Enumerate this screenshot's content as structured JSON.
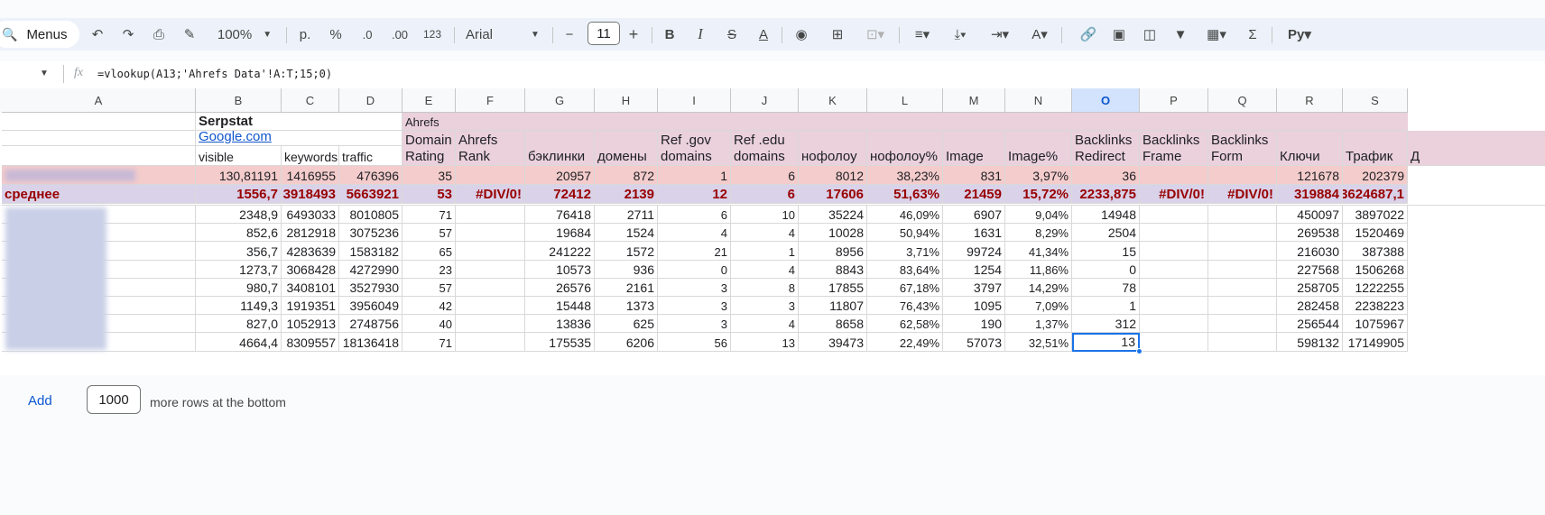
{
  "toolbar": {
    "menus_label": "Menus",
    "zoom": "100%",
    "currency": "р.",
    "percent": "%",
    "dec_decrease": ".0",
    "dec_increase": ".00",
    "number_format": "123",
    "font": "Arial",
    "font_size": "11"
  },
  "formula": {
    "text": "=vlookup(A13;'Ahrefs Data'!A:T;15;0)"
  },
  "columns": [
    "A",
    "B",
    "C",
    "D",
    "E",
    "F",
    "G",
    "H",
    "I",
    "J",
    "K",
    "L",
    "M",
    "N",
    "O",
    "P",
    "Q",
    "R",
    "S"
  ],
  "selected_column": "O",
  "header_rows": {
    "row1": {
      "serpstat": "Serpstat",
      "ahrefs": "Ahrefs"
    },
    "row2": {
      "google": "Google.com"
    },
    "row3": {
      "visible": "visible",
      "keywords": "keywords",
      "traffic": "traffic",
      "E": [
        "Domain",
        "Rating"
      ],
      "F": [
        "Ahrefs",
        "Rank"
      ],
      "G": "бэклинки",
      "H": "домены",
      "I": [
        "Ref .gov",
        "domains"
      ],
      "J": [
        "Ref .edu",
        "domains"
      ],
      "K": "нофолоу",
      "L": "нофолоу%",
      "M": "Image",
      "N": "Image%",
      "O": [
        "Backlinks",
        "Redirect"
      ],
      "P": [
        "Backlinks",
        "Frame"
      ],
      "Q": [
        "Backlinks",
        "Form"
      ],
      "R": "Ключи",
      "S": "Трафик",
      "T": "Д"
    }
  },
  "own_row": [
    "",
    "130,81191",
    "1416955",
    "476396",
    "35",
    "",
    "20957",
    "872",
    "1",
    "6",
    "8012",
    "38,23%",
    "831",
    "3,97%",
    "36",
    "",
    "",
    "121678",
    "202379"
  ],
  "avg_row": [
    "среднее",
    "1556,7",
    "3918493",
    "5663921",
    "53",
    "#DIV/0!",
    "72412",
    "2139",
    "12",
    "6",
    "17606",
    "51,63%",
    "21459",
    "15,72%",
    "2233,875",
    "#DIV/0!",
    "#DIV/0!",
    "319884",
    "3624687,1"
  ],
  "data_rows": [
    [
      "",
      "2348,9",
      "6493033",
      "8010805",
      "71",
      "",
      "76418",
      "2711",
      "6",
      "10",
      "35224",
      "46,09%",
      "6907",
      "9,04%",
      "14948",
      "",
      "",
      "450097",
      "3897022"
    ],
    [
      "",
      "852,6",
      "2812918",
      "3075236",
      "57",
      "",
      "19684",
      "1524",
      "4",
      "4",
      "10028",
      "50,94%",
      "1631",
      "8,29%",
      "2504",
      "",
      "",
      "269538",
      "1520469"
    ],
    [
      "",
      "356,7",
      "4283639",
      "1583182",
      "65",
      "",
      "241222",
      "1572",
      "21",
      "1",
      "8956",
      "3,71%",
      "99724",
      "41,34%",
      "15",
      "",
      "",
      "216030",
      "387388"
    ],
    [
      "",
      "1273,7",
      "3068428",
      "4272990",
      "23",
      "",
      "10573",
      "936",
      "0",
      "4",
      "8843",
      "83,64%",
      "1254",
      "11,86%",
      "0",
      "",
      "",
      "227568",
      "1506268"
    ],
    [
      "",
      "980,7",
      "3408101",
      "3527930",
      "57",
      "",
      "26576",
      "2161",
      "3",
      "8",
      "17855",
      "67,18%",
      "3797",
      "14,29%",
      "78",
      "",
      "",
      "258705",
      "1222255"
    ],
    [
      "",
      "1149,3",
      "1919351",
      "3956049",
      "42",
      "",
      "15448",
      "1373",
      "3",
      "3",
      "11807",
      "76,43%",
      "1095",
      "7,09%",
      "1",
      "",
      "",
      "282458",
      "2238223"
    ],
    [
      "",
      "827,0",
      "1052913",
      "2748756",
      "40",
      "",
      "13836",
      "625",
      "3",
      "4",
      "8658",
      "62,58%",
      "190",
      "1,37%",
      "312",
      "",
      "",
      "256544",
      "1075967"
    ],
    [
      "",
      "4664,4",
      "8309557",
      "18136418",
      "71",
      "",
      "175535",
      "6206",
      "56",
      "13",
      "39473",
      "22,49%",
      "57073",
      "32,51%",
      "13",
      "",
      "",
      "598132",
      "17149905"
    ]
  ],
  "bottom": {
    "add_label": "Add",
    "rows_value": "1000",
    "more_text": "more rows at the bottom"
  }
}
